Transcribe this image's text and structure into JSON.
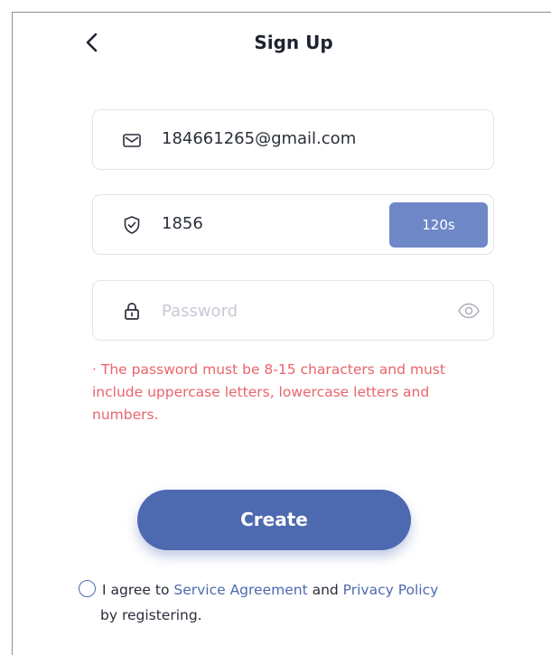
{
  "header": {
    "title": "Sign Up",
    "back_icon": "chevron-left-icon"
  },
  "email_field": {
    "icon": "mail-icon",
    "value": "184661265@gmail.com"
  },
  "code_field": {
    "icon": "shield-check-icon",
    "value": "1856",
    "timer_label": "120s"
  },
  "password_field": {
    "icon": "lock-icon",
    "placeholder": "Password",
    "value": "",
    "toggle_icon": "eye-icon"
  },
  "error": {
    "message": "· The password must be 8-15 characters and must include uppercase letters, lowercase letters and numbers."
  },
  "create_button": {
    "label": "Create"
  },
  "agreement": {
    "prefix": "I agree to ",
    "service_link": "Service Agreement",
    "conjunction": " and ",
    "privacy_link": "Privacy Policy",
    "suffix": "by registering."
  },
  "colors": {
    "accent": "#4d69b0",
    "timer_bg": "#6e87c7",
    "error": "#e8656b",
    "border": "#e1e4ee"
  }
}
